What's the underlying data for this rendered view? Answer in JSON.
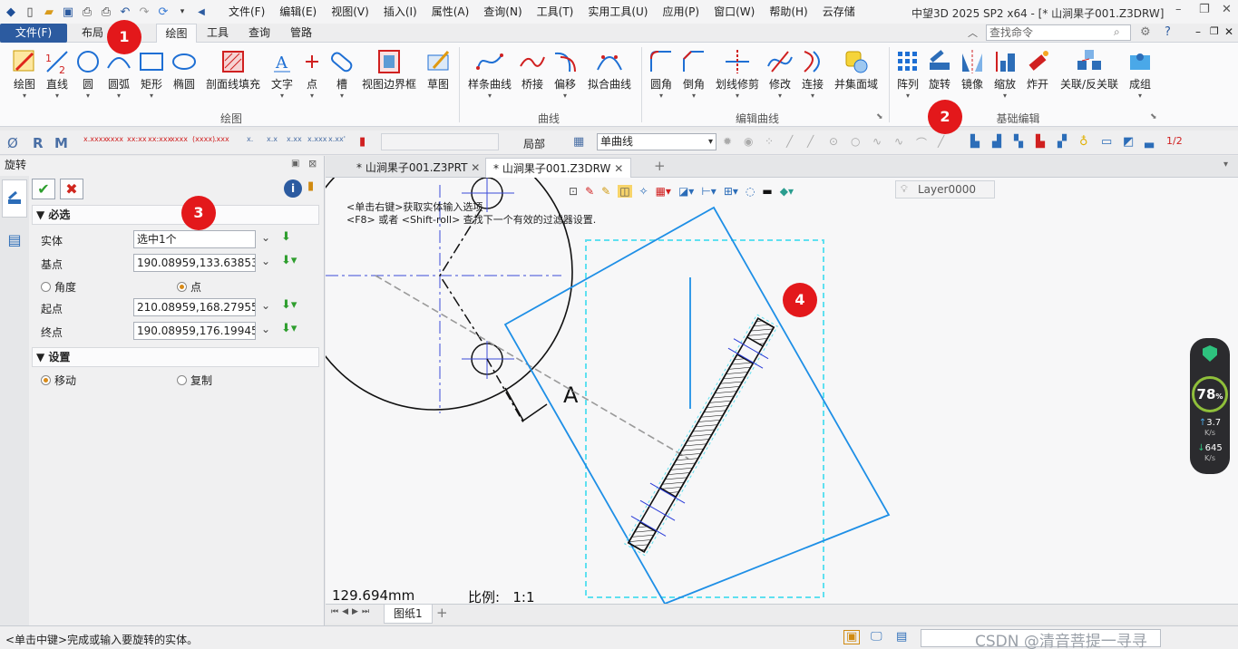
{
  "title_bar": {
    "window_title": "中望3D 2025 SP2 x64 - [* 山涧果子001.Z3DRW]",
    "menus": [
      "文件(F)",
      "编辑(E)",
      "视图(V)",
      "插入(I)",
      "属性(A)",
      "查询(N)",
      "工具(T)",
      "实用工具(U)",
      "应用(P)",
      "窗口(W)",
      "帮助(H)",
      "云存储"
    ]
  },
  "ribbon_tabs": {
    "items": [
      "文件(F)",
      "布局",
      "绘图",
      "工具",
      "查询",
      "管路"
    ],
    "active": "绘图",
    "search_placeholder": "查找命令"
  },
  "ribbon": {
    "groups": [
      {
        "label": "绘图",
        "buttons": [
          "绘图",
          "直线",
          "圆",
          "圆弧",
          "矩形",
          "椭圆",
          "剖面线填充",
          "文字",
          "点",
          "槽",
          "视图边界框",
          "草图"
        ]
      },
      {
        "label": "曲线",
        "buttons": [
          "样条曲线",
          "桥接",
          "偏移",
          "拟合曲线"
        ]
      },
      {
        "label": "编辑曲线",
        "buttons": [
          "圆角",
          "倒角",
          "划线修剪",
          "修改",
          "连接",
          "并集面域"
        ]
      },
      {
        "label": "基础编辑",
        "buttons": [
          "阵列",
          "旋转",
          "镜像",
          "缩放",
          "炸开",
          "关联/反关联",
          "成组"
        ]
      }
    ]
  },
  "toolbar": {
    "scope_label": "局部",
    "curve_filter": "单曲线"
  },
  "panel": {
    "title": "旋转",
    "required_header": "必选",
    "fields": [
      {
        "label": "实体",
        "value": "选中1个"
      },
      {
        "label": "基点",
        "value": "190.08959,133.63853"
      }
    ],
    "mode_options": [
      "角度",
      "点"
    ],
    "mode_selected": "点",
    "point_fields": [
      {
        "label": "起点",
        "value": "210.08959,168.27955"
      },
      {
        "label": "终点",
        "value": "190.08959,176.19945"
      }
    ],
    "settings_header": "设置",
    "settings_options": [
      "移动",
      "复制"
    ],
    "settings_selected": "移动"
  },
  "doc_tabs": [
    "* 山涧果子001.Z3PRT",
    "* 山涧果子001.Z3DRW"
  ],
  "active_doc_tab": "* 山涧果子001.Z3DRW",
  "canvas": {
    "hint_line1": "<单击右键>获取实体输入选项",
    "hint_line2": "<F8> 或者 <Shift-roll> 查找下一个有效的过滤器设置.",
    "measure": "129.694mm",
    "scale_label": "比例:",
    "scale_value": "1:1",
    "letter_label": "A",
    "layer": "Layer0000"
  },
  "sheet_tab": "图纸1",
  "status": {
    "text": "<单击中键>完成或输入要旋转的实体。",
    "watermark": "CSDN @清音菩提一寻寻"
  },
  "monitor": {
    "percent": "78",
    "percent_unit": "%",
    "up_value": "3.7",
    "up_unit": "K/s",
    "down_value": "645",
    "down_unit": "K/s"
  },
  "badges": [
    "1",
    "2",
    "3",
    "4"
  ],
  "colors": {
    "accent_blue": "#2c5ba0",
    "badge_red": "#e3181b",
    "selection_blue": "#1e8fe6",
    "cyan_dashed": "#5fe0f0"
  }
}
